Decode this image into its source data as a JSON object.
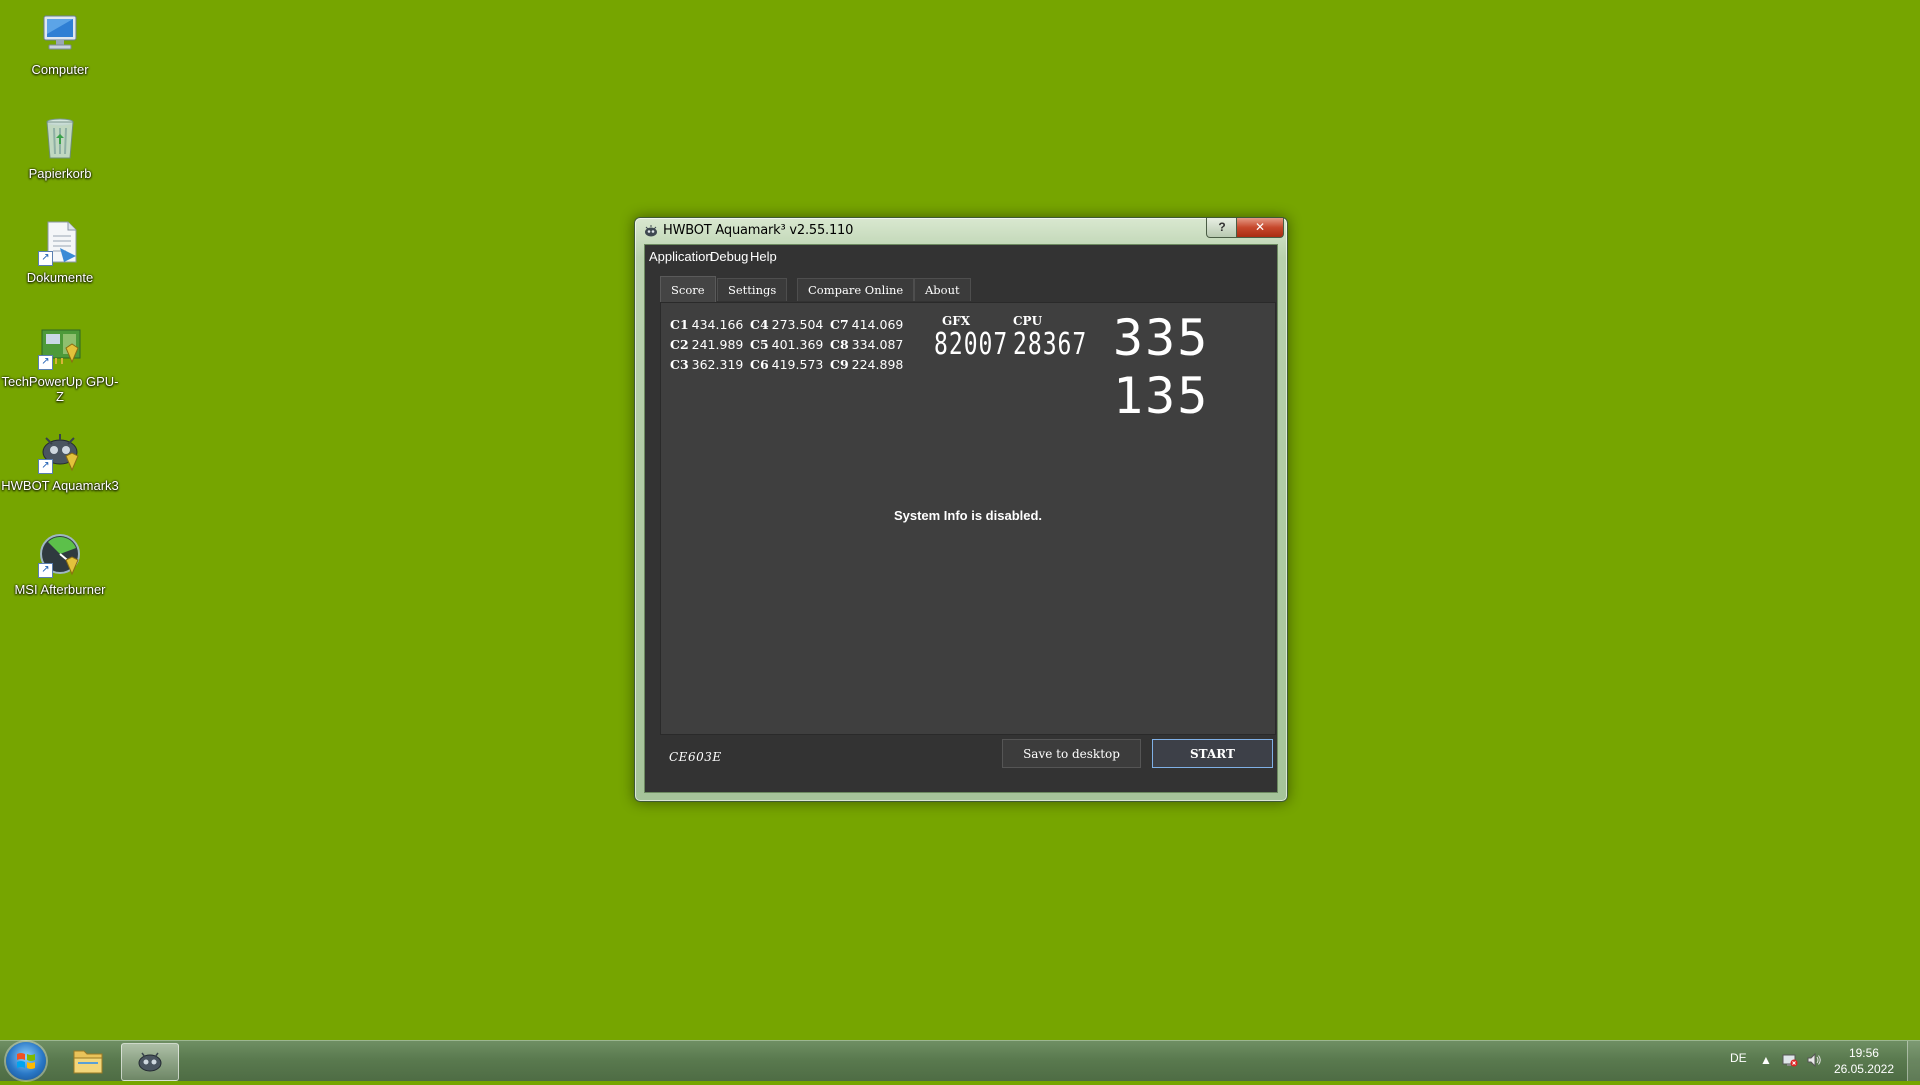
{
  "desktop": {
    "icons": [
      {
        "label": "Computer",
        "icon": "computer-icon"
      },
      {
        "label": "Papierkorb",
        "icon": "recycle-bin-icon"
      },
      {
        "label": "Dokumente",
        "icon": "documents-icon"
      },
      {
        "label": "TechPowerUp GPU-Z",
        "icon": "gpu-z-icon"
      },
      {
        "label": "HWBOT Aquamark3",
        "icon": "aquamark-icon"
      },
      {
        "label": "MSI Afterburner",
        "icon": "afterburner-icon"
      }
    ]
  },
  "window": {
    "title": "HWBOT Aquamark³ v2.55.110",
    "help_label": "?",
    "close_label": "✕",
    "menu": [
      "Application",
      "Debug",
      "Help"
    ],
    "tabs": [
      "Score",
      "Settings",
      "Compare Online",
      "About"
    ],
    "active_tab": "Score",
    "scores": [
      {
        "id": "C1",
        "value": "434.166"
      },
      {
        "id": "C2",
        "value": "241.989"
      },
      {
        "id": "C3",
        "value": "362.319"
      },
      {
        "id": "C4",
        "value": "273.504"
      },
      {
        "id": "C5",
        "value": "401.369"
      },
      {
        "id": "C6",
        "value": "419.573"
      },
      {
        "id": "C7",
        "value": "414.069"
      },
      {
        "id": "C8",
        "value": "334.087"
      },
      {
        "id": "C9",
        "value": "224.898"
      }
    ],
    "gfx_label": "GFX",
    "gfx_value": "82007",
    "cpu_label": "CPU",
    "cpu_value": "28367",
    "total_score": "335 135",
    "sysinfo_message": "System Info is disabled.",
    "code": "CE603E",
    "save_button": "Save to desktop",
    "start_button": "START"
  },
  "taskbar": {
    "language": "DE",
    "time": "19:56",
    "date": "26.05.2022"
  },
  "colors": {
    "desktop_bg": "#76a500",
    "window_client_bg": "#333333",
    "start_button_border": "#7fb0e6"
  }
}
